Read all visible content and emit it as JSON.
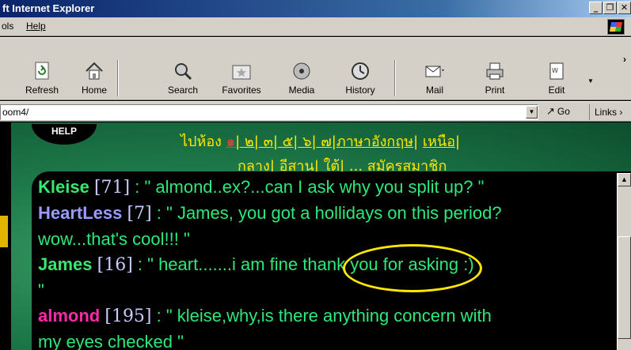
{
  "window": {
    "title": "ft Internet Explorer",
    "controls": [
      "_",
      "D",
      "×"
    ]
  },
  "menu": {
    "tools_label": "ols",
    "help_label": "Help"
  },
  "toolbar": {
    "buttons": [
      {
        "label": "Refresh",
        "icon": "refresh-icon"
      },
      {
        "label": "Home",
        "icon": "home-icon"
      },
      {
        "label": "Search",
        "icon": "search-icon"
      },
      {
        "label": "Favorites",
        "icon": "favorites-icon"
      },
      {
        "label": "Media",
        "icon": "media-icon"
      },
      {
        "label": "History",
        "icon": "history-icon"
      },
      {
        "label": "Mail",
        "icon": "mail-icon"
      },
      {
        "label": "Print",
        "icon": "print-icon"
      },
      {
        "label": "Edit",
        "icon": "edit-icon"
      }
    ],
    "overflow": "›"
  },
  "address": {
    "value": "oom4/",
    "go_label": "Go",
    "links_label": "Links"
  },
  "page": {
    "help_label": "HELP",
    "nav_line1_prefix": "ไปห้อง",
    "nav_room1": "๑",
    "nav_rooms": "| ๒| ๓| ๕| ๖| ๗|",
    "nav_english": "ภาษาอังกฤษ",
    "nav_sep1": "| ",
    "nav_north": "เหนือ",
    "nav_sep2": "|",
    "nav_line2": "กลาง| อีสาน| ใต้| ... สมัครสมาชิก"
  },
  "chat": [
    {
      "name": "Kleise",
      "count": "[71]",
      "text": " : \" almond..ex?...can I ask why you split up?   \""
    },
    {
      "name": "HeartLess",
      "count": "[7]",
      "text": " : \" James, you got a hollidays on this period?"
    },
    {
      "name": "",
      "count": "",
      "text": "wow...that's cool!!!   \""
    },
    {
      "name": "James",
      "count": "[16]",
      "text": " : \" heart.......i am fine thank you for asking :)"
    },
    {
      "name": "",
      "count": "",
      "text": "  \""
    },
    {
      "name": "almond",
      "count": "[195]",
      "text": " : \" kleise,why,is there anything concern with"
    },
    {
      "name": "",
      "count": "",
      "text": "my eyes checked    \""
    }
  ],
  "colors": {
    "accent_yellow": "#ffe800",
    "chat_green": "#2ee87a",
    "almond_pink": "#ff2aa8",
    "heartless_blue": "#9b9bff"
  }
}
